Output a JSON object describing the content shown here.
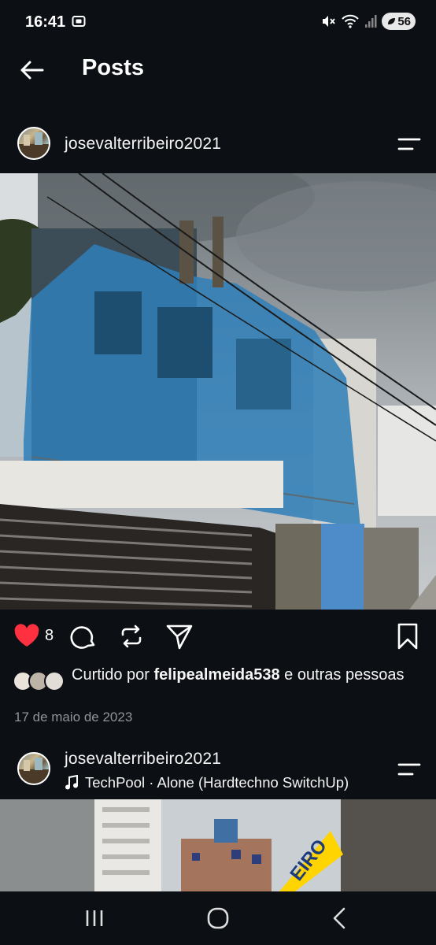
{
  "status_bar": {
    "time": "16:41",
    "battery": "56",
    "icons": [
      "screenshot-icon",
      "mute-icon",
      "wifi-icon",
      "signal-icon",
      "battery-icon"
    ]
  },
  "header": {
    "title": "Posts"
  },
  "post1": {
    "username": "josevalterribeiro2021",
    "like_count": "8",
    "likes_prefix": "Curtido por ",
    "likes_user": "felipealmeida538",
    "likes_suffix": " e outras pessoas",
    "date": "17 de maio de 2023"
  },
  "post2": {
    "username": "josevalterribeiro2021",
    "music": "TechPool · Alone (Hardtechno SwitchUp)",
    "overlay_text": "EIRO"
  },
  "colors": {
    "background": "#0c1014",
    "like_red": "#ff3040",
    "date_gray": "#8e9499",
    "net_blue": "#2f7fb8",
    "overlay_yellow": "#ffd400"
  }
}
